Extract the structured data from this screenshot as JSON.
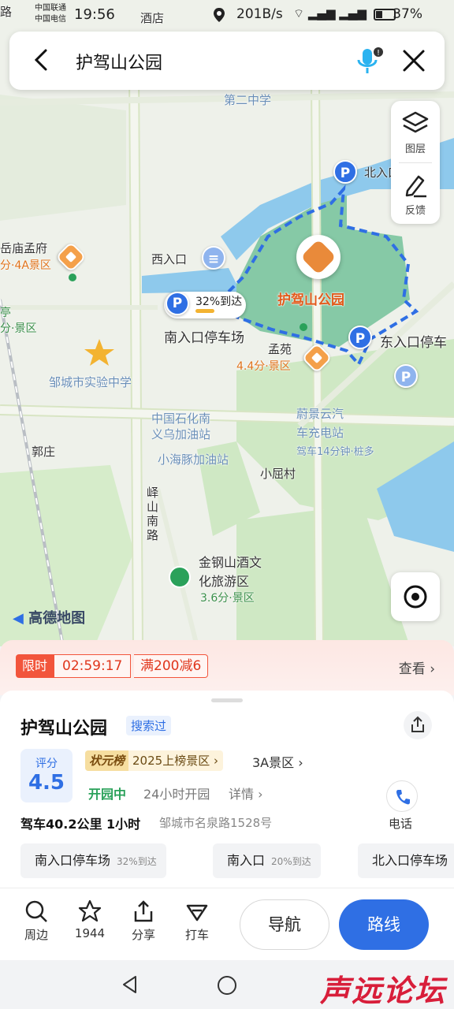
{
  "status": {
    "carrier1": "中国联通",
    "carrier2": "中国电信",
    "time": "19:56",
    "speed": "201B/s",
    "battery": "37%"
  },
  "search": {
    "query": "护驾山公园",
    "icons": [
      "back-icon",
      "mic-icon",
      "close-icon"
    ]
  },
  "tools": {
    "layers": "图层",
    "feedback": "反馈"
  },
  "map": {
    "labels": {
      "school2": "第二中学",
      "north_gate": "北入口停车场",
      "west_gate": "西入口",
      "park": "护驾山公园",
      "south_parking_pct": "32%到达",
      "south_parking": "南入口停车场",
      "east_parking": "东入口停车",
      "mengyuan": "孟苑",
      "mengyuan_sub": "4.4分·景区",
      "yuemiao": "岳庙孟府",
      "yuemiao_sub": "分·4A景区",
      "ting": "亭",
      "ting_sub": "分·景区",
      "exp_school": "邹城市实验中学",
      "sinopec1": "中国石化南",
      "sinopec2": "义乌加油站",
      "ev1": "蔚景云汽",
      "ev2": "车充电站",
      "ev_sub": "驾车14分钟·桩多",
      "guozhuang": "郭庄",
      "dolphin": "小海豚加油站",
      "xiaoqu": "小屈村",
      "road": "峄山南路",
      "jingang1": "金钢山酒文",
      "jingang2": "化旅游区",
      "jingang_sub": "3.6分·景区",
      "logo": "高德地图",
      "top_road": "路",
      "top_hotel": "酒店"
    }
  },
  "promo": {
    "tag": "限时",
    "countdown": "02:59:17",
    "offer": "满200减6",
    "view": "查看"
  },
  "place": {
    "name": "护驾山公园",
    "searched": "搜索过",
    "score_label": "评分",
    "score": "4.5",
    "rank_badge": "状元榜",
    "rank_text": "2025上榜景区",
    "level": "3A景区",
    "open_status": "开园中",
    "hours": "24小时开园",
    "detail": "详情",
    "drive": "驾车40.2公里 1小时",
    "address": "邹城市名泉路1528号",
    "phone_label": "电话"
  },
  "chips": [
    {
      "label": "南入口停车场",
      "pct": "32%到达"
    },
    {
      "label": "南入口",
      "pct": "20%到达"
    },
    {
      "label": "北入口停车场",
      "pct": ""
    }
  ],
  "bottom": {
    "nearby": "周边",
    "fav_count": "1944",
    "share": "分享",
    "taxi": "打车",
    "navigate": "导航",
    "route": "路线"
  },
  "watermark": "声远论坛",
  "colors": {
    "primary": "#2f6fe4",
    "accent_orange": "#e25b1c",
    "promo_red": "#f2553c",
    "park_green": "#86c9a6",
    "water": "#8ec9ec"
  }
}
